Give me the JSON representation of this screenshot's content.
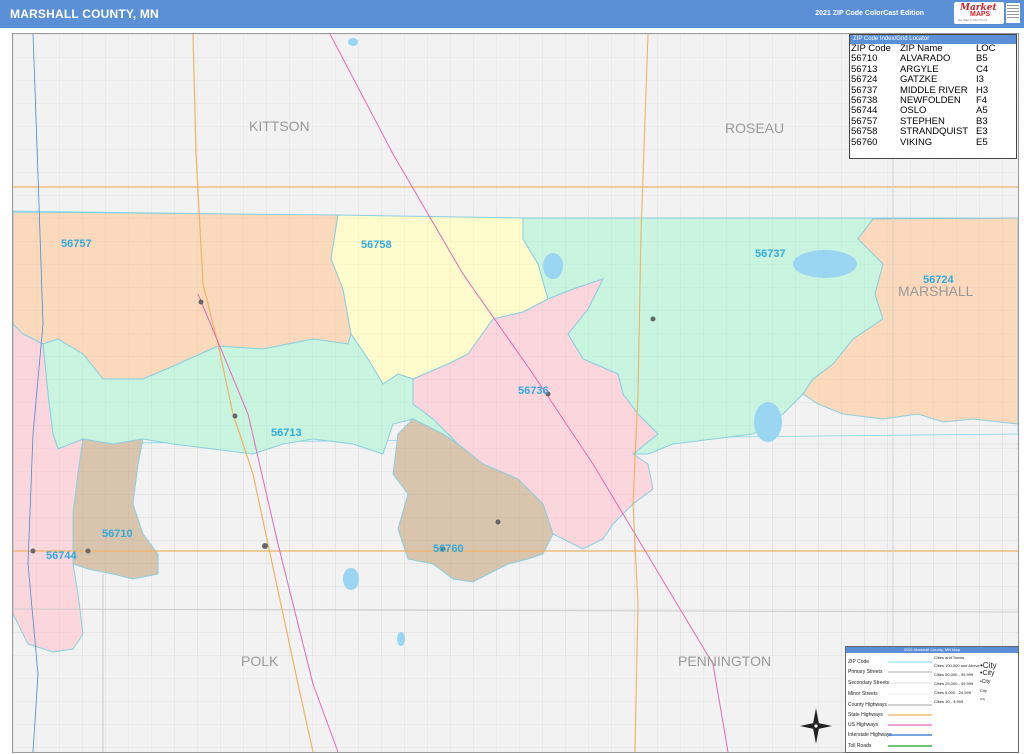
{
  "header": {
    "title": "MARSHALL COUNTY, MN",
    "edition": "2021 ZIP Code ColorCast Edition"
  },
  "logo": {
    "line1": "Market",
    "line2": "MAPS",
    "tagline": "We Map It. We Print It."
  },
  "colors": {
    "header": "#5b8fd6",
    "zip_56757": "#fbd9bd",
    "zip_56758": "#fefccd",
    "zip_56713": "#c8f4e0",
    "zip_56736": "#fbd6dc",
    "zip_56737": "#c8f4e0",
    "zip_56724": "#fbd9bd",
    "zip_56744": "#fbd6dc",
    "zip_56710": "#d9c4ad",
    "zip_56760": "#d9c4ad",
    "water": "#9ad5f2",
    "zip_label": "#33aadd"
  },
  "map": {
    "regions": {
      "kittson": "KITTSON",
      "roseau": "ROSEAU",
      "marshall": "MARSHALL",
      "polk": "POLK",
      "pennington": "PENNINGTON"
    },
    "zip_labels": [
      "56757",
      "56758",
      "56737",
      "56724",
      "56736",
      "56713",
      "56710",
      "56744",
      "56760"
    ]
  },
  "index": {
    "title": "ZIP Code Index/Grid Locator",
    "headers": [
      "ZIP Code",
      "ZIP Name",
      "LOC"
    ],
    "rows": [
      [
        "56710",
        "ALVARADO",
        "B5"
      ],
      [
        "56713",
        "ARGYLE",
        "C4"
      ],
      [
        "56724",
        "GATZKE",
        "I3"
      ],
      [
        "56737",
        "MIDDLE RIVER",
        "H3"
      ],
      [
        "56738",
        "NEWFOLDEN",
        "F4"
      ],
      [
        "56744",
        "OSLO",
        "A5"
      ],
      [
        "56757",
        "STEPHEN",
        "B3"
      ],
      [
        "56758",
        "STRANDQUIST",
        "E3"
      ],
      [
        "56760",
        "VIKING",
        "E5"
      ]
    ]
  },
  "legend": {
    "title": "2021 Marshall County, MN Map",
    "items": [
      "ZIP Code",
      "Primary Streets",
      "Secondary Streets",
      "Minor Streets",
      "County Highways",
      "State Highways",
      "US Highways",
      "Interstate Highways",
      "Toll Roads"
    ],
    "cities_title": "Cities and Towns",
    "cities": [
      [
        "Cities 100,000 and Above",
        "•City"
      ],
      [
        "Cities 50,000 - 99,999",
        "•City"
      ],
      [
        "Cities 25,000 - 49,999",
        "•City"
      ],
      [
        "Cities 5,000 - 24,999",
        "City"
      ],
      [
        "Cities 10 - 4,999",
        "City"
      ]
    ]
  }
}
